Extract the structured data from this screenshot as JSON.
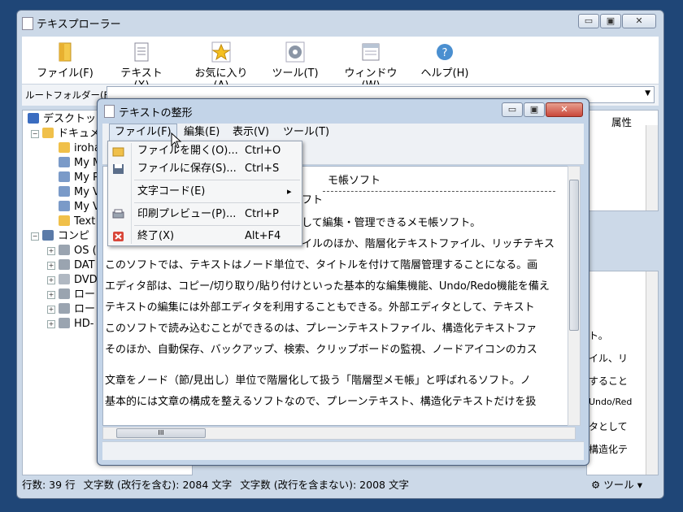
{
  "main": {
    "title": "テキスプローラー",
    "toolbar": [
      {
        "label": "ファイル(F)",
        "icon": "folder-icon"
      },
      {
        "label": "テキスト(X)",
        "icon": "document-icon"
      },
      {
        "label": "お気に入り(A)",
        "icon": "star-icon"
      },
      {
        "label": "ツール(T)",
        "icon": "gear-icon"
      },
      {
        "label": "ウィンドウ(W)",
        "icon": "window-icon"
      },
      {
        "label": "ヘルプ(H)",
        "icon": "help-icon"
      }
    ],
    "root_folder_label": "ルートフォルダー(F):",
    "tree": [
      {
        "label": "デスクトップ"
      },
      {
        "label": "ドキュメ"
      },
      {
        "label": "iroha"
      },
      {
        "label": "My M"
      },
      {
        "label": "My P"
      },
      {
        "label": "My V"
      },
      {
        "label": "My V"
      },
      {
        "label": "Text"
      },
      {
        "label": "コンピ"
      },
      {
        "label": "OS ("
      },
      {
        "label": "DAT"
      },
      {
        "label": "DVD"
      },
      {
        "label": "ロー"
      },
      {
        "label": "ロー"
      },
      {
        "label": "HD-"
      }
    ],
    "right_header": "属性",
    "right_view_lines": [
      "ト。",
      "イル、リ",
      "すること",
      "Undo/Red",
      "タとして",
      "構造化テ"
    ],
    "status": {
      "lines": "行数: 39 行",
      "chars_with_newline": "文字数 (改行を含む): 2084 文字",
      "chars_without_newline": "文字数 (改行を含まない): 2008 文字",
      "tools_label": "ツール"
    }
  },
  "dialog": {
    "title": "テキストの整形",
    "menu": [
      "ファイル(F)",
      "編集(E)",
      "表示(V)",
      "ツール(T)"
    ],
    "lines": [
      "モ帳ソフト",
      "フト",
      "して編集・管理できるメモ帳ソフト。",
      "イルのほか、階層化テキストファイル、リッチテキス",
      "このソフトでは、テキストはノード単位で、タイトルを付けて階層管理することになる。画",
      "エディタ部は、コピー/切り取り/貼り付けといった基本的な編集機能、Undo/Redo機能を備え",
      "テキストの編集には外部エディタを利用することもできる。外部エディタとして、テキスト",
      "このソフトで読み込むことができるのは、プレーンテキストファイル、構造化テキストファ",
      "そのほか、自動保存、バックアップ、検索、クリップボードの監視、ノードアイコンのカス",
      "",
      "文章をノード（節/見出し）単位で階層化して扱う「階層型メモ帳」と呼ばれるソフト。ノ",
      "基本的には文章の構成を整えるソフトなので、プレーンテキスト、構造化テキストだけを扱"
    ],
    "hscroll_grip": "III"
  },
  "file_menu": [
    {
      "label": "ファイルを開く(O)...",
      "shortcut": "Ctrl+O",
      "icon": "open-folder-icon"
    },
    {
      "label": "ファイルに保存(S)...",
      "shortcut": "Ctrl+S",
      "icon": "save-icon"
    },
    {
      "label": "文字コード(E)",
      "shortcut": "",
      "icon": "",
      "submenu": "▸"
    },
    {
      "label": "印刷プレビュー(P)...",
      "shortcut": "Ctrl+P",
      "icon": "print-preview-icon"
    },
    {
      "label": "終了(X)",
      "shortcut": "Alt+F4",
      "icon": "exit-icon"
    }
  ],
  "colors": {
    "desktop": "#1f4677",
    "frame": "#ccd9e8",
    "close_red": "#c9473a"
  }
}
